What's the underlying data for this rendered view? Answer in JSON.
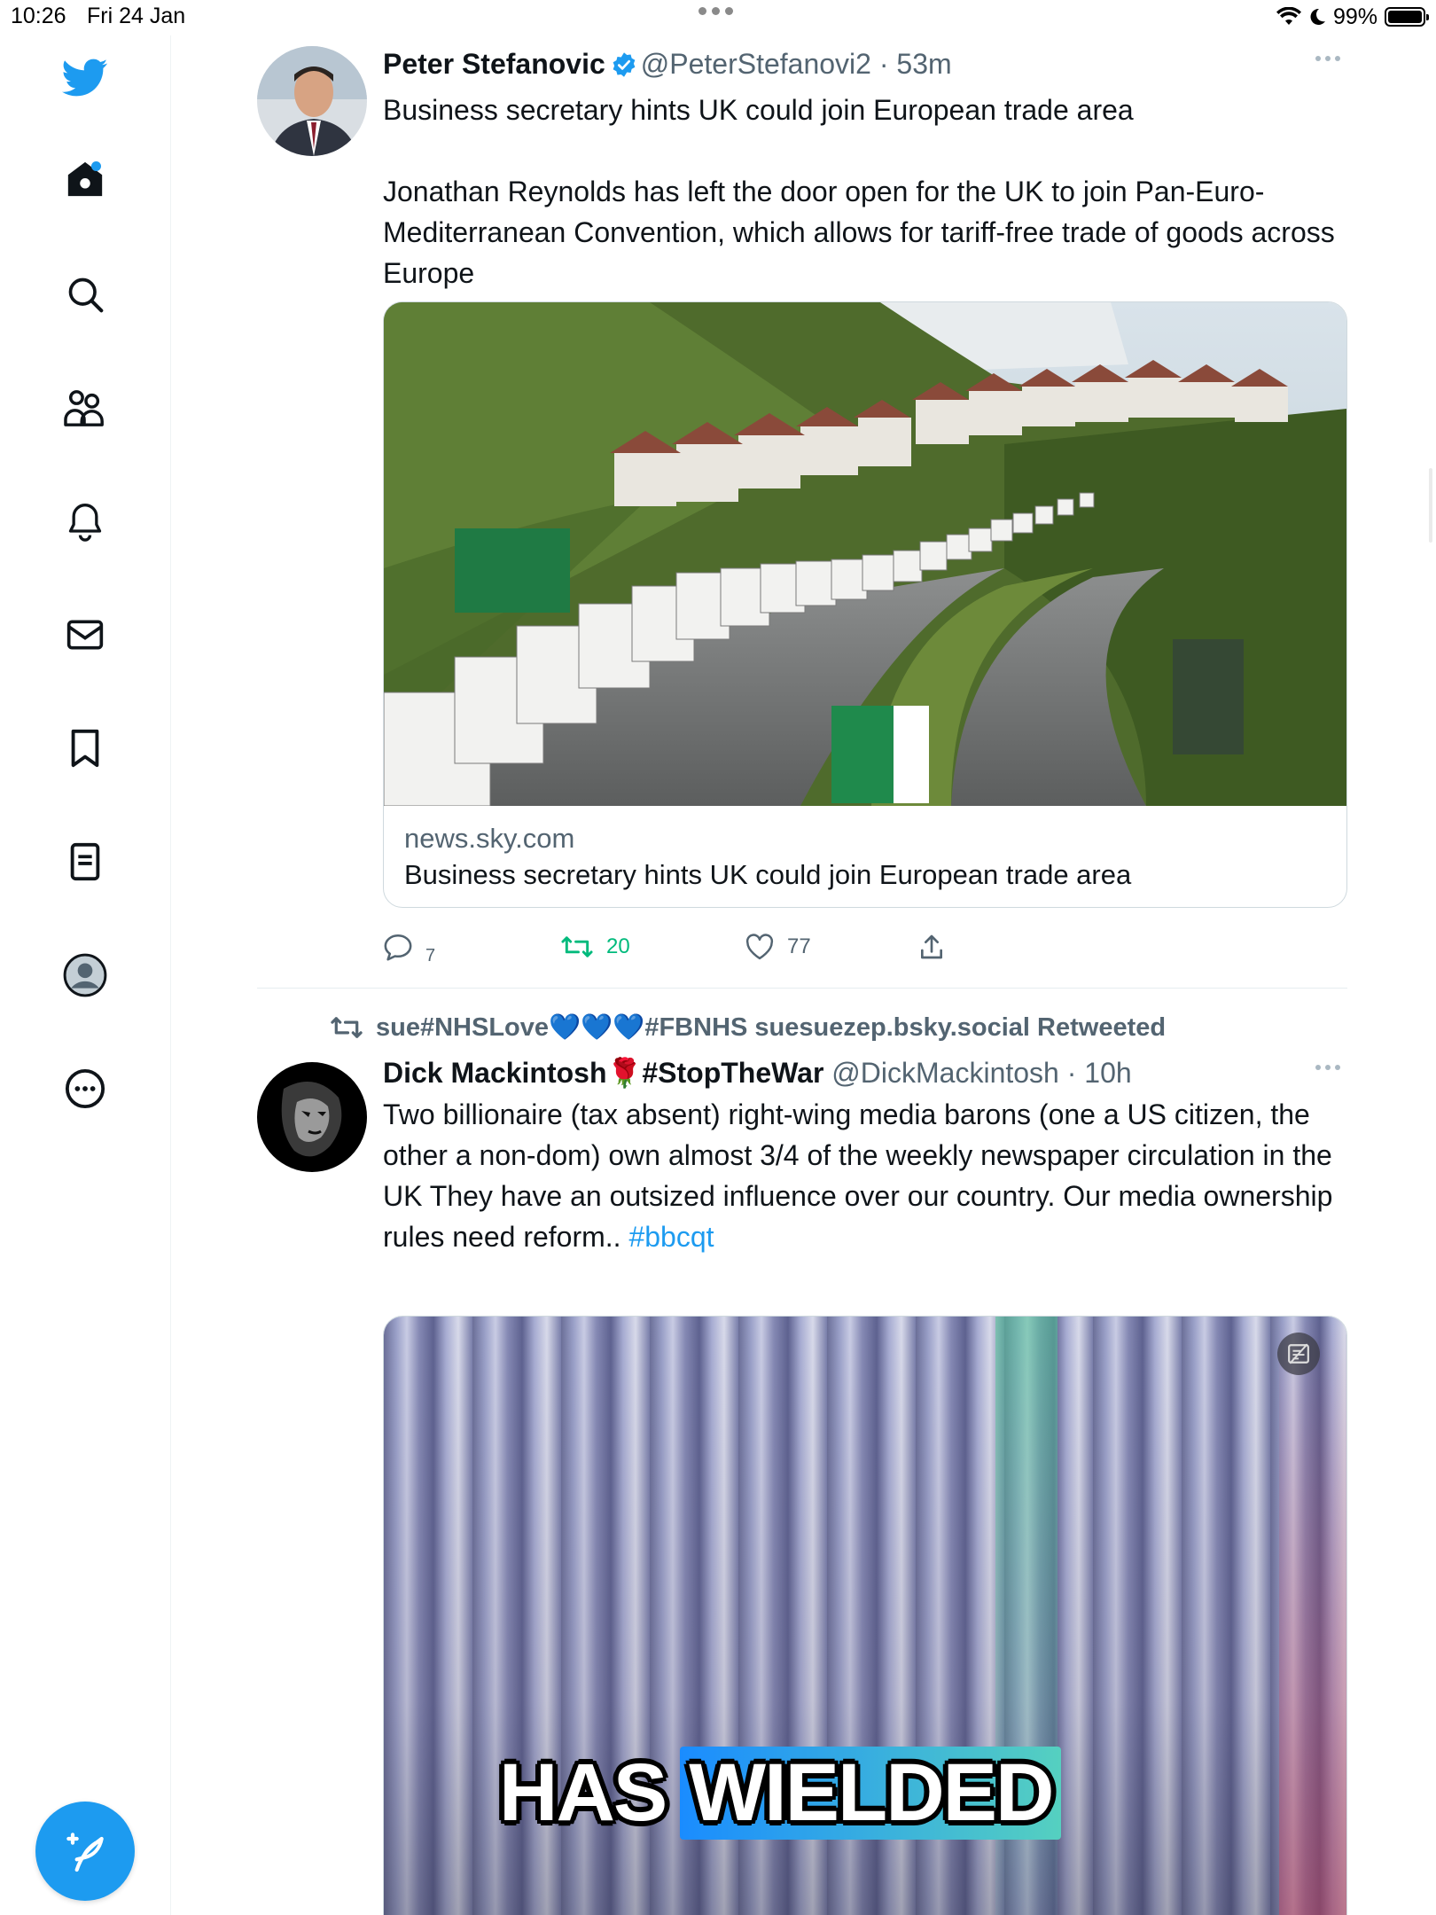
{
  "status_bar": {
    "time": "10:26",
    "date": "Fri 24 Jan",
    "battery": "99%",
    "battery_level": 0.99
  },
  "sidebar": {
    "items": [
      "twitter-logo",
      "home",
      "search",
      "communities",
      "notifications",
      "messages",
      "bookmarks",
      "lists",
      "profile",
      "more"
    ],
    "accent": "#1d9bf0"
  },
  "tweets": [
    {
      "name": "Peter Stefanovic",
      "handle": "@PeterStefanovi2",
      "sep": "·",
      "time": "53m",
      "verified": true,
      "text": "Business secretary hints UK could join European trade area\n\nJonathan Reynolds has left the door open for the UK to join Pan-Euro-Mediterranean Convention, which allows for tariff-free trade of goods across Europe",
      "card": {
        "domain": "news.sky.com",
        "title": "Business secretary hints UK could join European trade area"
      },
      "reply_count": "7",
      "retweet_count": "20",
      "like_count": "77"
    },
    {
      "retweeted_by": "sue#NHSLove💙💙💙#FBNHS suesuezep.bsky.social Retweeted",
      "name": "Dick Mackintosh🌹#StopTheWar",
      "handle": "@DickMackintosh",
      "sep": "·",
      "time": "10h",
      "text": "Two billionaire (tax absent) right-wing media barons (one a US citizen, the other a non-dom) own almost 3/4 of the weekly newspaper circulation in the UK They have an outsized influence over our country. Our media ownership rules need reform.. ",
      "hashtag": "#bbcqt",
      "video_caption_1": "HAS",
      "video_caption_2": "WIELDED"
    }
  ]
}
